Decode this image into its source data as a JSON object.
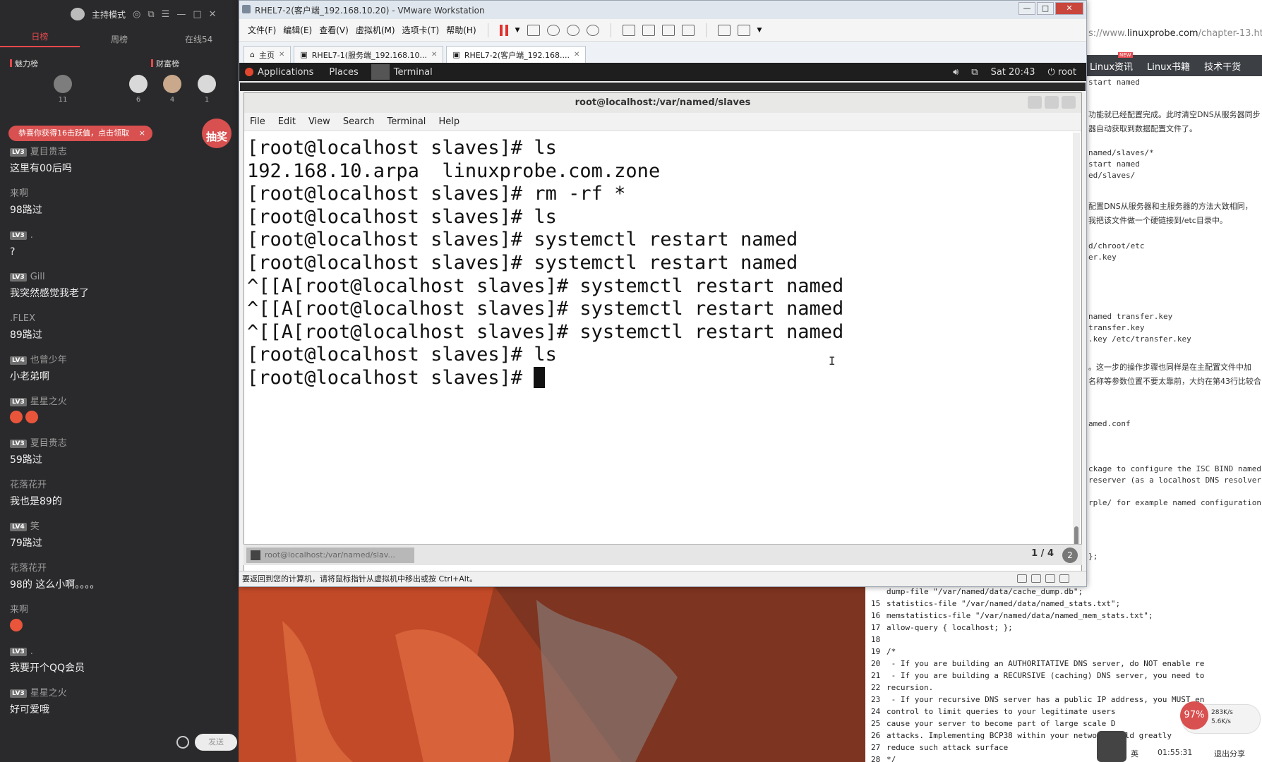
{
  "chat": {
    "title": "主持模式",
    "tabs": [
      "日榜",
      "周榜",
      "在线54"
    ],
    "ranks": [
      "魅力榜",
      "财富榜"
    ],
    "rank_counts": [
      "11",
      "6",
      "4",
      "1"
    ],
    "promo": "恭喜你获得16击跃值，点击领取",
    "promo_close": "×",
    "lottery": "抽奖",
    "messages": [
      {
        "level": "LV3",
        "name": "夏目贵志",
        "text": "这里有00后吗"
      },
      {
        "level": "",
        "name": "来啊",
        "text": "98路过"
      },
      {
        "level": "LV3",
        "name": ".",
        "text": "?"
      },
      {
        "level": "LV3",
        "name": "Gill",
        "text": "我突然感觉我老了"
      },
      {
        "level": "",
        "name": ".FLEX",
        "text": "89路过"
      },
      {
        "level": "LV4",
        "name": "也曾少年",
        "text": "小老弟啊"
      },
      {
        "level": "LV3",
        "name": "星星之火",
        "text": ""
      },
      {
        "level": "LV3",
        "name": "夏目贵志",
        "text": "59路过"
      },
      {
        "level": "",
        "name": "花落花开",
        "text": "我也是89的"
      },
      {
        "level": "LV4",
        "name": "笑",
        "text": "79路过"
      },
      {
        "level": "",
        "name": "花落花开",
        "text": "98的  这么小啊。。。。"
      },
      {
        "level": "",
        "name": "来啊",
        "text": ""
      },
      {
        "level": "LV3",
        "name": ".",
        "text": "我要开个QQ会员"
      },
      {
        "level": "LV3",
        "name": "星星之火",
        "text": "好可爱哦"
      }
    ],
    "send_label": "发送"
  },
  "vmware": {
    "title": "RHEL7-2(客户端_192.168.10.20) - VMware Workstation",
    "window_controls": [
      "—",
      "□",
      "✕"
    ],
    "menu": [
      "文件(F)",
      "编辑(E)",
      "查看(V)",
      "虚拟机(M)",
      "选项卡(T)",
      "帮助(H)"
    ],
    "tabs": [
      {
        "label": "主页"
      },
      {
        "label": "RHEL7-1(服务端_192.168.10..."
      },
      {
        "label": "RHEL7-2(客户端_192.168...."
      }
    ],
    "status_hint": "要返回到您的计算机，请将鼠标指针从虚拟机中移出或按 Ctrl+Alt。"
  },
  "gnome": {
    "applications": "Applications",
    "places": "Places",
    "terminal": "Terminal",
    "clock": "Sat 20:43",
    "user": "root"
  },
  "terminal": {
    "title": "root@localhost:/var/named/slaves",
    "menu": [
      "File",
      "Edit",
      "View",
      "Search",
      "Terminal",
      "Help"
    ],
    "lines": [
      "[root@localhost slaves]# ls",
      "192.168.10.arpa  linuxprobe.com.zone",
      "[root@localhost slaves]# rm -rf *",
      "[root@localhost slaves]# ls",
      "[root@localhost slaves]# systemctl restart named",
      "[root@localhost slaves]# systemctl restart named",
      "^[[A[root@localhost slaves]# systemctl restart named",
      "^[[A[root@localhost slaves]# systemctl restart named",
      "^[[A[root@localhost slaves]# systemctl restart named",
      "[root@localhost slaves]# ls",
      "[root@localhost slaves]# "
    ],
    "task_item": "root@localhost:/var/named/slav...",
    "workspace": "1 / 4",
    "workspace_badge": "2"
  },
  "doc": {
    "url_prefix": "s://www.",
    "url_domain": "linuxprobe.com",
    "url_suffix": "/chapter-13.ht",
    "nav": [
      "Linux资讯",
      "Linux书籍",
      "技术干货"
    ],
    "nav_badge": "NEW",
    "lines": [
      "start named",
      "功能就已经配置完成。此时清空DNS从服务器同步",
      "器自动获取到数据配置文件了。",
      "named/slaves/*",
      "start named",
      "ed/slaves/",
      "配置DNS从服务器和主服务器的方法大致相同，",
      "我把该文件做一个硬链接到/etc目录中。",
      "d/chroot/etc",
      "er.key",
      "named transfer.key",
      "transfer.key",
      ".key /etc/transfer.key",
      "。这一步的操作步骤也同样是在主配置文件中加",
      "名称等参数位置不要太靠前，大约在第43行比较合",
      "amed.conf",
      "ckage to configure the ISC BIND named",
      "reserver (as a localhost DNS resolver",
      "rple/ for example named configuration",
      "};"
    ],
    "code": [
      {
        "n": "",
        "t": "dump-file \"/var/named/data/cache_dump.db\";"
      },
      {
        "n": "15",
        "t": "statistics-file \"/var/named/data/named_stats.txt\";"
      },
      {
        "n": "16",
        "t": "memstatistics-file \"/var/named/data/named_mem_stats.txt\";"
      },
      {
        "n": "17",
        "t": "allow-query { localhost; };"
      },
      {
        "n": "18",
        "t": ""
      },
      {
        "n": "19",
        "t": "/*"
      },
      {
        "n": "20",
        "t": " - If you are building an AUTHORITATIVE DNS server, do NOT enable re"
      },
      {
        "n": "21",
        "t": " - If you are building a RECURSIVE (caching) DNS server, you need to"
      },
      {
        "n": "22",
        "t": "recursion."
      },
      {
        "n": "23",
        "t": " - If your recursive DNS server has a public IP address, you MUST en"
      },
      {
        "n": "24",
        "t": "control to limit queries to your legitimate users"
      },
      {
        "n": "25",
        "t": "cause your server to become part of large scale D"
      },
      {
        "n": "26",
        "t": "attacks. Implementing BCP38 within your network would greatly"
      },
      {
        "n": "27",
        "t": "reduce such attack surface"
      },
      {
        "n": "28",
        "t": "*/"
      }
    ]
  },
  "widgets": {
    "gauge": "97%",
    "up_speed": "283K/s",
    "down_speed": "5.6K/s",
    "ime": "英",
    "timer": "01:55:31",
    "exit_share": "退出分享"
  },
  "colors": {
    "accent": "#e5484d",
    "chat_bg": "#2a2a2c",
    "terminal_fg": "#111111",
    "desktop": "#b8462a"
  }
}
